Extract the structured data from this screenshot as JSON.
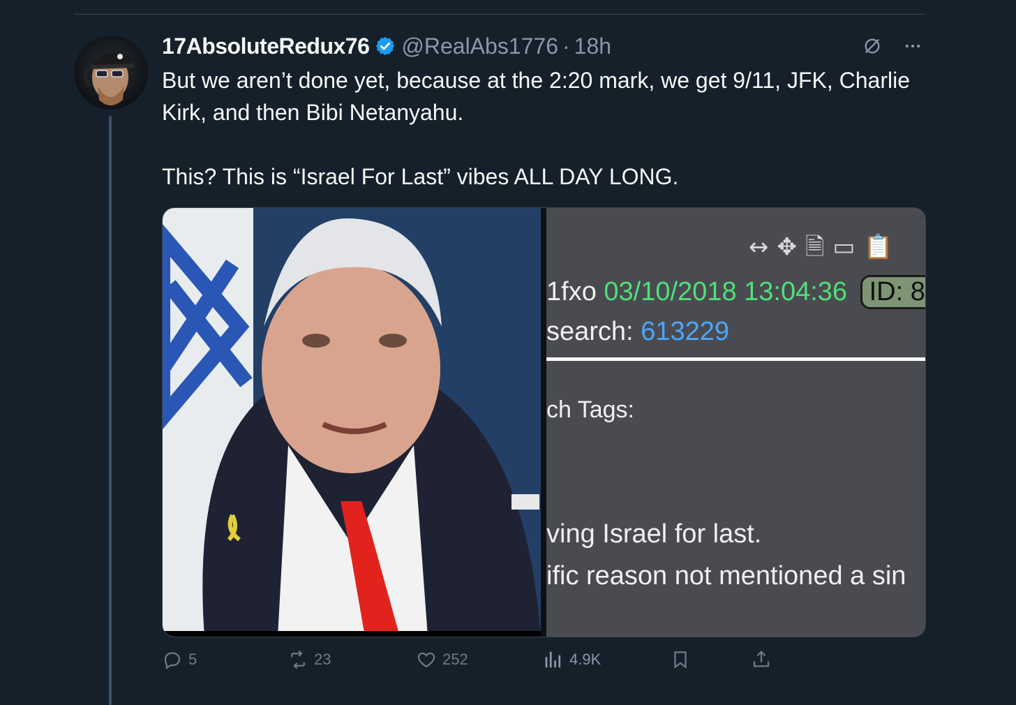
{
  "tweet": {
    "display_name": "17AbsoluteRedux76",
    "handle": "@RealAbs1776",
    "separator": "·",
    "time": "18h",
    "text_line1": "But we aren’t done yet, because at the 2:20 mark, we get 9/11, JFK, Charlie Kirk, and then Bibi Netanyahu.",
    "text_line2": "This? This is “Israel For Last” vibes ALL DAY LONG."
  },
  "media_screenshot": {
    "toolbar_icons": [
      "↔",
      "✥",
      "🗎",
      "▭",
      "📋"
    ],
    "post_id_fragment": "1fxo",
    "date": "03/10/2018 13:04:36",
    "id_label": "ID: 8",
    "search_label": "search:",
    "search_number": "613229",
    "tags_label": "ch Tags:",
    "line_a": "ving Israel for last.",
    "line_b": "ific reason not mentioned a sin"
  },
  "actions": {
    "replies": "5",
    "reposts": "23",
    "likes": "252",
    "views": "4.9K"
  },
  "colors": {
    "background": "#15202b",
    "verified_badge": "#1d9bf0",
    "muted_text": "#8b98a5",
    "date_green": "#4ee07a",
    "link_blue": "#4aa6ff"
  },
  "icons": [
    "verified-badge-icon",
    "grok-icon",
    "more-icon",
    "reply-icon",
    "repost-icon",
    "like-icon",
    "views-icon",
    "bookmark-icon",
    "share-icon"
  ]
}
